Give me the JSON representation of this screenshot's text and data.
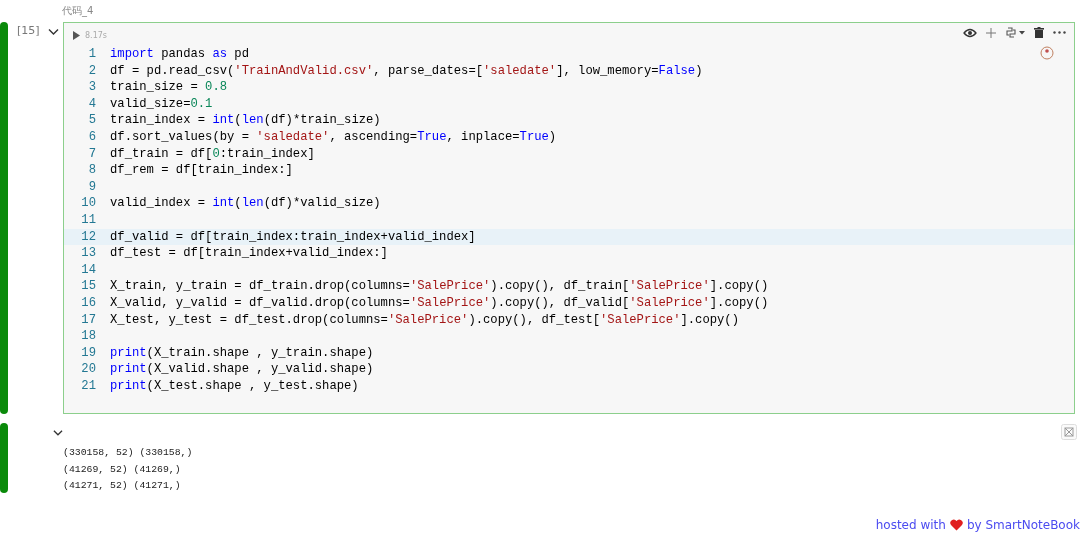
{
  "cell_title": "代码_4",
  "cell": {
    "execution_count": "[15]",
    "expanded": true,
    "duration": "8.17s",
    "lines": [
      {
        "number": "1",
        "selected": false,
        "tokens": [
          {
            "kind": "kw",
            "text": "import"
          },
          {
            "kind": "plain",
            "text": " pandas "
          },
          {
            "kind": "kw",
            "text": "as"
          },
          {
            "kind": "plain",
            "text": " pd"
          }
        ]
      },
      {
        "number": "2",
        "selected": false,
        "tokens": [
          {
            "kind": "plain",
            "text": "df = pd.read_csv("
          },
          {
            "kind": "str",
            "text": "'TrainAndValid.csv'"
          },
          {
            "kind": "plain",
            "text": ", parse_dates=["
          },
          {
            "kind": "str",
            "text": "'saledate'"
          },
          {
            "kind": "plain",
            "text": "], low_memory="
          },
          {
            "kind": "kw",
            "text": "False"
          },
          {
            "kind": "plain",
            "text": ")"
          }
        ]
      },
      {
        "number": "3",
        "selected": false,
        "tokens": [
          {
            "kind": "plain",
            "text": "train_size = "
          },
          {
            "kind": "num",
            "text": "0.8"
          }
        ]
      },
      {
        "number": "4",
        "selected": false,
        "tokens": [
          {
            "kind": "plain",
            "text": "valid_size="
          },
          {
            "kind": "num",
            "text": "0.1"
          }
        ]
      },
      {
        "number": "5",
        "selected": false,
        "tokens": [
          {
            "kind": "plain",
            "text": "train_index = "
          },
          {
            "kind": "kw",
            "text": "int"
          },
          {
            "kind": "plain",
            "text": "("
          },
          {
            "kind": "kw",
            "text": "len"
          },
          {
            "kind": "plain",
            "text": "(df)*train_size)"
          }
        ]
      },
      {
        "number": "6",
        "selected": false,
        "tokens": [
          {
            "kind": "plain",
            "text": "df.sort_values(by = "
          },
          {
            "kind": "str",
            "text": "'saledate'"
          },
          {
            "kind": "plain",
            "text": ", ascending="
          },
          {
            "kind": "kw",
            "text": "True"
          },
          {
            "kind": "plain",
            "text": ", inplace="
          },
          {
            "kind": "kw",
            "text": "True"
          },
          {
            "kind": "plain",
            "text": ")"
          }
        ]
      },
      {
        "number": "7",
        "selected": false,
        "tokens": [
          {
            "kind": "plain",
            "text": "df_train = df["
          },
          {
            "kind": "num",
            "text": "0"
          },
          {
            "kind": "plain",
            "text": ":train_index]"
          }
        ]
      },
      {
        "number": "8",
        "selected": false,
        "tokens": [
          {
            "kind": "plain",
            "text": "df_rem = df[train_index:]"
          }
        ]
      },
      {
        "number": "9",
        "selected": false
      },
      {
        "number": "10",
        "selected": false,
        "tokens": [
          {
            "kind": "plain",
            "text": "valid_index = "
          },
          {
            "kind": "kw",
            "text": "int"
          },
          {
            "kind": "plain",
            "text": "("
          },
          {
            "kind": "kw",
            "text": "len"
          },
          {
            "kind": "plain",
            "text": "(df)*valid_size)"
          }
        ]
      },
      {
        "number": "11",
        "selected": false
      },
      {
        "number": "12",
        "selected": true,
        "tokens": [
          {
            "kind": "plain",
            "text": "df_valid = df[train_index:train_index+valid_index]"
          }
        ]
      },
      {
        "number": "13",
        "selected": false,
        "tokens": [
          {
            "kind": "plain",
            "text": "df_test = df[train_index+valid_index:]"
          }
        ]
      },
      {
        "number": "14",
        "selected": false
      },
      {
        "number": "15",
        "selected": false,
        "tokens": [
          {
            "kind": "plain",
            "text": "X_train, y_train = df_train.drop(columns="
          },
          {
            "kind": "str",
            "text": "'SalePrice'"
          },
          {
            "kind": "plain",
            "text": ").copy(), df_train["
          },
          {
            "kind": "str",
            "text": "'SalePrice'"
          },
          {
            "kind": "plain",
            "text": "].copy()"
          }
        ]
      },
      {
        "number": "16",
        "selected": false,
        "tokens": [
          {
            "kind": "plain",
            "text": "X_valid, y_valid = df_valid.drop(columns="
          },
          {
            "kind": "str",
            "text": "'SalePrice'"
          },
          {
            "kind": "plain",
            "text": ").copy(), df_valid["
          },
          {
            "kind": "str",
            "text": "'SalePrice'"
          },
          {
            "kind": "plain",
            "text": "].copy()"
          }
        ]
      },
      {
        "number": "17",
        "selected": false,
        "tokens": [
          {
            "kind": "plain",
            "text": "X_test, y_test = df_test.drop(columns="
          },
          {
            "kind": "str",
            "text": "'SalePrice'"
          },
          {
            "kind": "plain",
            "text": ").copy(), df_test["
          },
          {
            "kind": "str",
            "text": "'SalePrice'"
          },
          {
            "kind": "plain",
            "text": "].copy()"
          }
        ]
      },
      {
        "number": "18",
        "selected": false
      },
      {
        "number": "19",
        "selected": false,
        "tokens": [
          {
            "kind": "kw",
            "text": "print"
          },
          {
            "kind": "plain",
            "text": "(X_train.shape , y_train.shape)"
          }
        ]
      },
      {
        "number": "20",
        "selected": false,
        "tokens": [
          {
            "kind": "kw",
            "text": "print"
          },
          {
            "kind": "plain",
            "text": "(X_valid.shape , y_valid.shape)"
          }
        ]
      },
      {
        "number": "21",
        "selected": false,
        "tokens": [
          {
            "kind": "kw",
            "text": "print"
          },
          {
            "kind": "plain",
            "text": "(X_test.shape , y_test.shape)"
          }
        ]
      }
    ]
  },
  "output": {
    "expanded": true,
    "lines": [
      "(330158, 52) (330158,)",
      "(41269, 52) (41269,)",
      "(41271, 52) (41271,)"
    ]
  },
  "footer": {
    "before": "hosted with",
    "after": "by SmartNoteBook"
  }
}
